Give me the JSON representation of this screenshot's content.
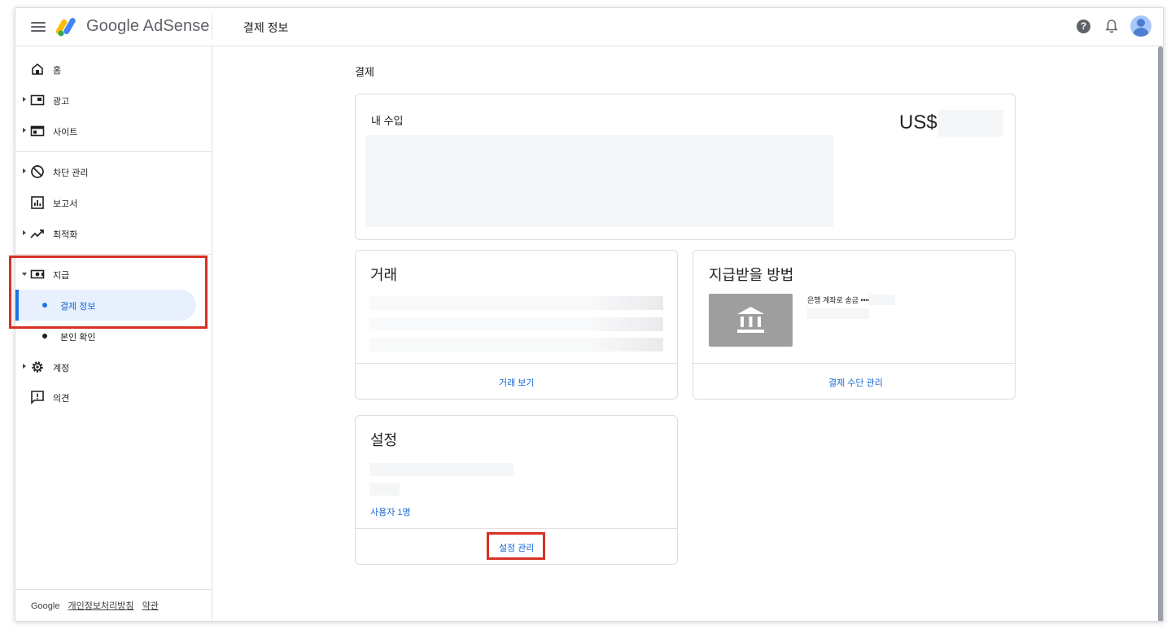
{
  "header": {
    "brand_google": "Google",
    "brand_product": "AdSense",
    "page_title": "결제 정보",
    "help_glyph": "?"
  },
  "sidebar": {
    "items": [
      {
        "label": "홈",
        "icon": "home-icon"
      },
      {
        "label": "광고",
        "icon": "ads-icon"
      },
      {
        "label": "사이트",
        "icon": "sites-icon"
      },
      {
        "label": "차단 관리",
        "icon": "block-icon"
      },
      {
        "label": "보고서",
        "icon": "reports-icon"
      },
      {
        "label": "최적화",
        "icon": "optimize-icon"
      },
      {
        "label": "지급",
        "icon": "payments-icon"
      },
      {
        "label": "결제 정보",
        "icon": "dot-icon",
        "active": true
      },
      {
        "label": "본인 확인",
        "icon": "dot-icon"
      },
      {
        "label": "계정",
        "icon": "gear-icon"
      },
      {
        "label": "의견",
        "icon": "feedback-icon"
      }
    ],
    "footer": {
      "google": "Google",
      "privacy": "개인정보처리방침",
      "terms": "약관"
    }
  },
  "main": {
    "section_title": "결제",
    "earnings_card": {
      "title": "내 수입",
      "currency": "US$"
    },
    "transactions_card": {
      "title": "거래",
      "link": "거래 보기"
    },
    "payment_method_card": {
      "title": "지급받을 방법",
      "bank_label": "은행 계좌로 송금 ••••",
      "link": "결제 수단 관리"
    },
    "settings_card": {
      "title": "설정",
      "users_link": "사용자 1명",
      "manage_link": "설정 관리"
    }
  },
  "colors": {
    "accent_blue": "#1a73e8",
    "link_blue": "#1967d2",
    "highlight_red": "#d93025",
    "active_bg": "#e8f0fe"
  }
}
